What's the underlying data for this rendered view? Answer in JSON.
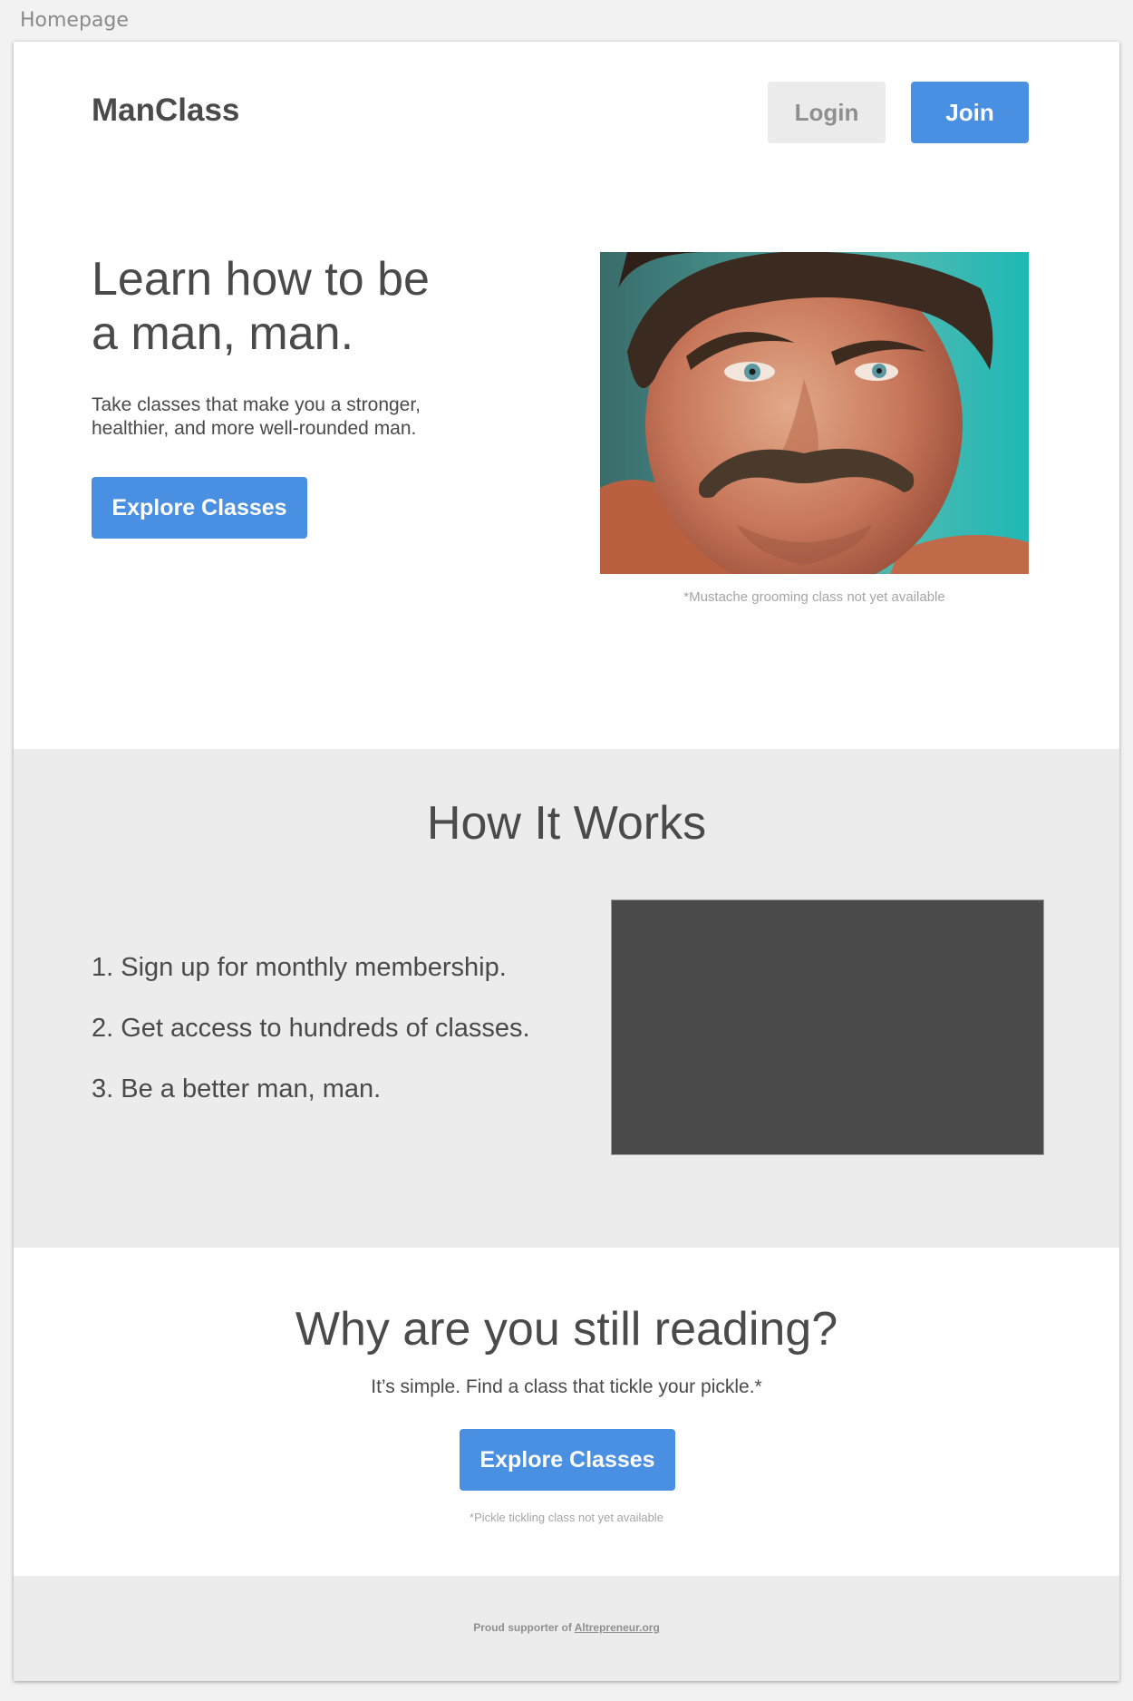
{
  "artboard": {
    "label": "Homepage"
  },
  "header": {
    "logo": "ManClass",
    "login_label": "Login",
    "join_label": "Join"
  },
  "hero": {
    "title_line1": "Learn how to be",
    "title_line2": "a man, man.",
    "subtitle_line1": "Take classes that make you a stronger,",
    "subtitle_line2": "healthier, and more well-rounded man.",
    "cta_label": "Explore Classes",
    "photo_caption": "*Mustache grooming class not yet available"
  },
  "how_it_works": {
    "title": "How It Works",
    "steps": [
      "1. Sign up for monthly membership.",
      "2. Get access to hundreds of classes.",
      "3. Be a better man, man."
    ]
  },
  "cta": {
    "title": "Why are you still reading?",
    "subtitle": "It’s simple. Find a class that tickle your pickle.*",
    "button_label": "Explore Classes",
    "caption": "*Pickle tickling class not yet available"
  },
  "footer": {
    "prefix": "Proud supporter of",
    "link_label": "Altrepreneur.org"
  },
  "colors": {
    "primary": "#4a90e2",
    "text": "#4a4a4a",
    "muted": "#a5a5a5",
    "section_bg": "#ececec",
    "placeholder": "#4a4a4a"
  }
}
